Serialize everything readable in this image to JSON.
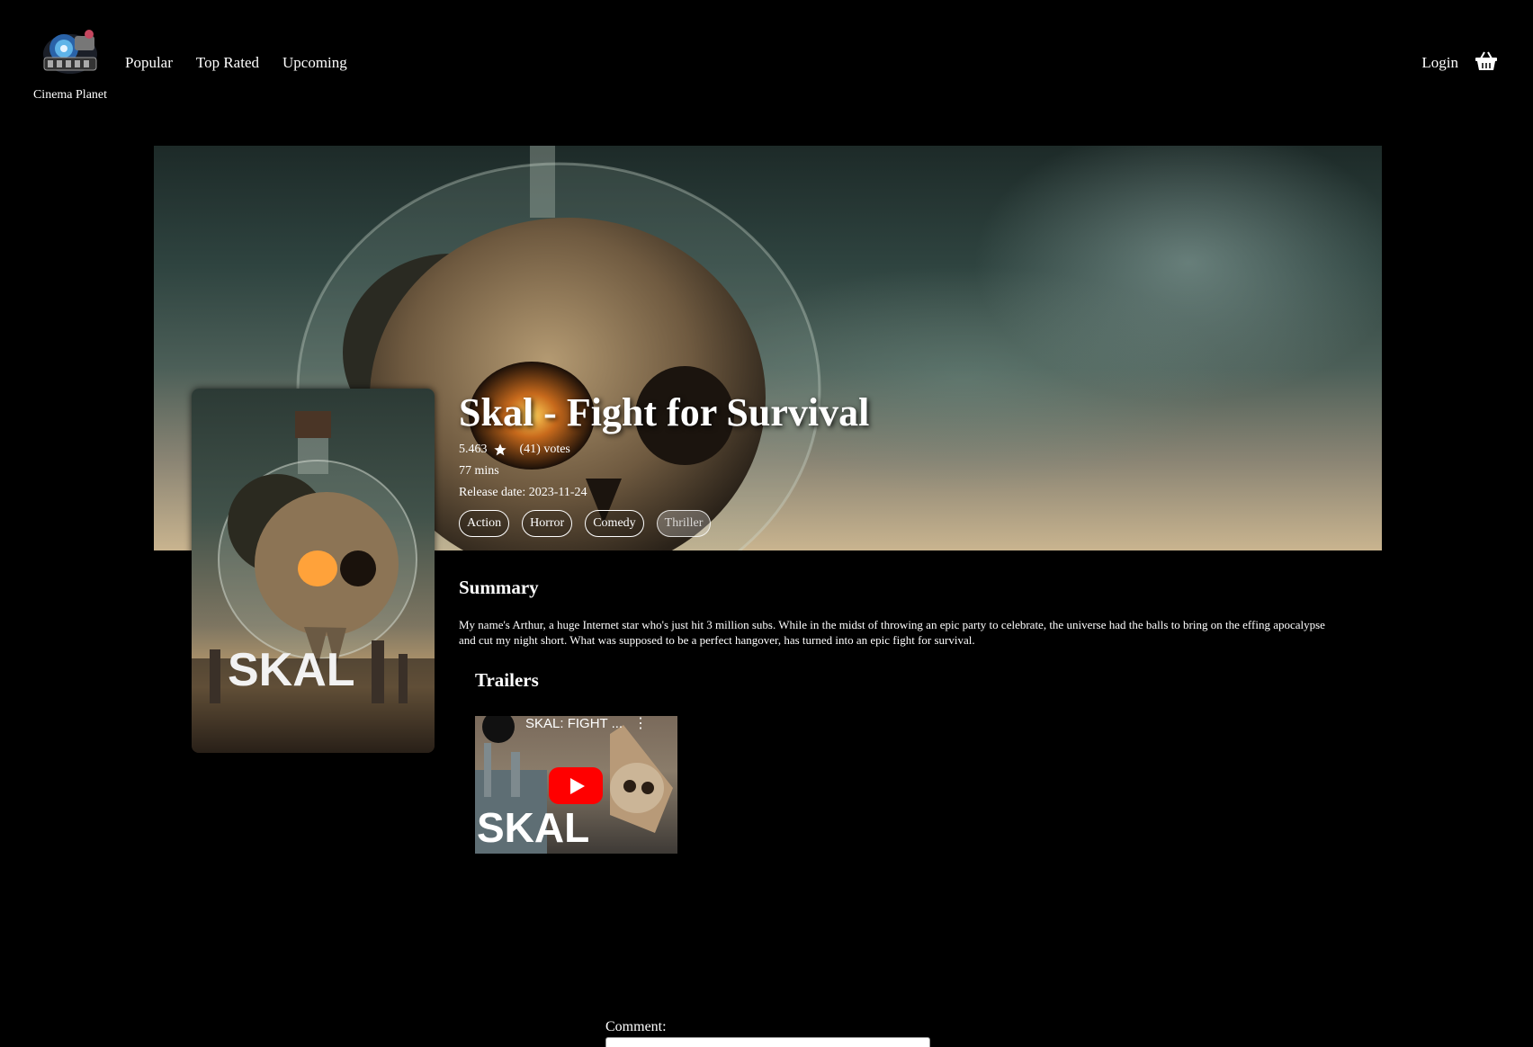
{
  "header": {
    "brand_name": "Cinema Planet",
    "nav": [
      "Popular",
      "Top Rated",
      "Upcoming"
    ],
    "login": "Login",
    "icons": {
      "logo": "cinema-planet-logo",
      "cart": "basket-icon"
    }
  },
  "movie": {
    "title": "Skal - Fight for Survival",
    "rating": "5.463",
    "votes": "(41) votes",
    "runtime": "77 mins",
    "release": "Release date: 2023-11-24",
    "genres": [
      "Action",
      "Horror",
      "Comedy",
      "Thriller"
    ],
    "poster_text": "SKAL"
  },
  "summary": {
    "heading": "Summary",
    "text": "My name's Arthur, a huge Internet star who's just hit 3 million subs. While in the midst of throwing an epic party to celebrate, the universe had the balls to bring on the effing apocalypse and cut my night short. What was supposed to be a perfect hangover, has turned into an epic fight for survival."
  },
  "trailers": {
    "heading": "Trailers",
    "items": [
      {
        "title": "SKAL: FIGHT ...",
        "overlay_text": "SKAL"
      }
    ]
  },
  "comment": {
    "label": "Comment:"
  }
}
